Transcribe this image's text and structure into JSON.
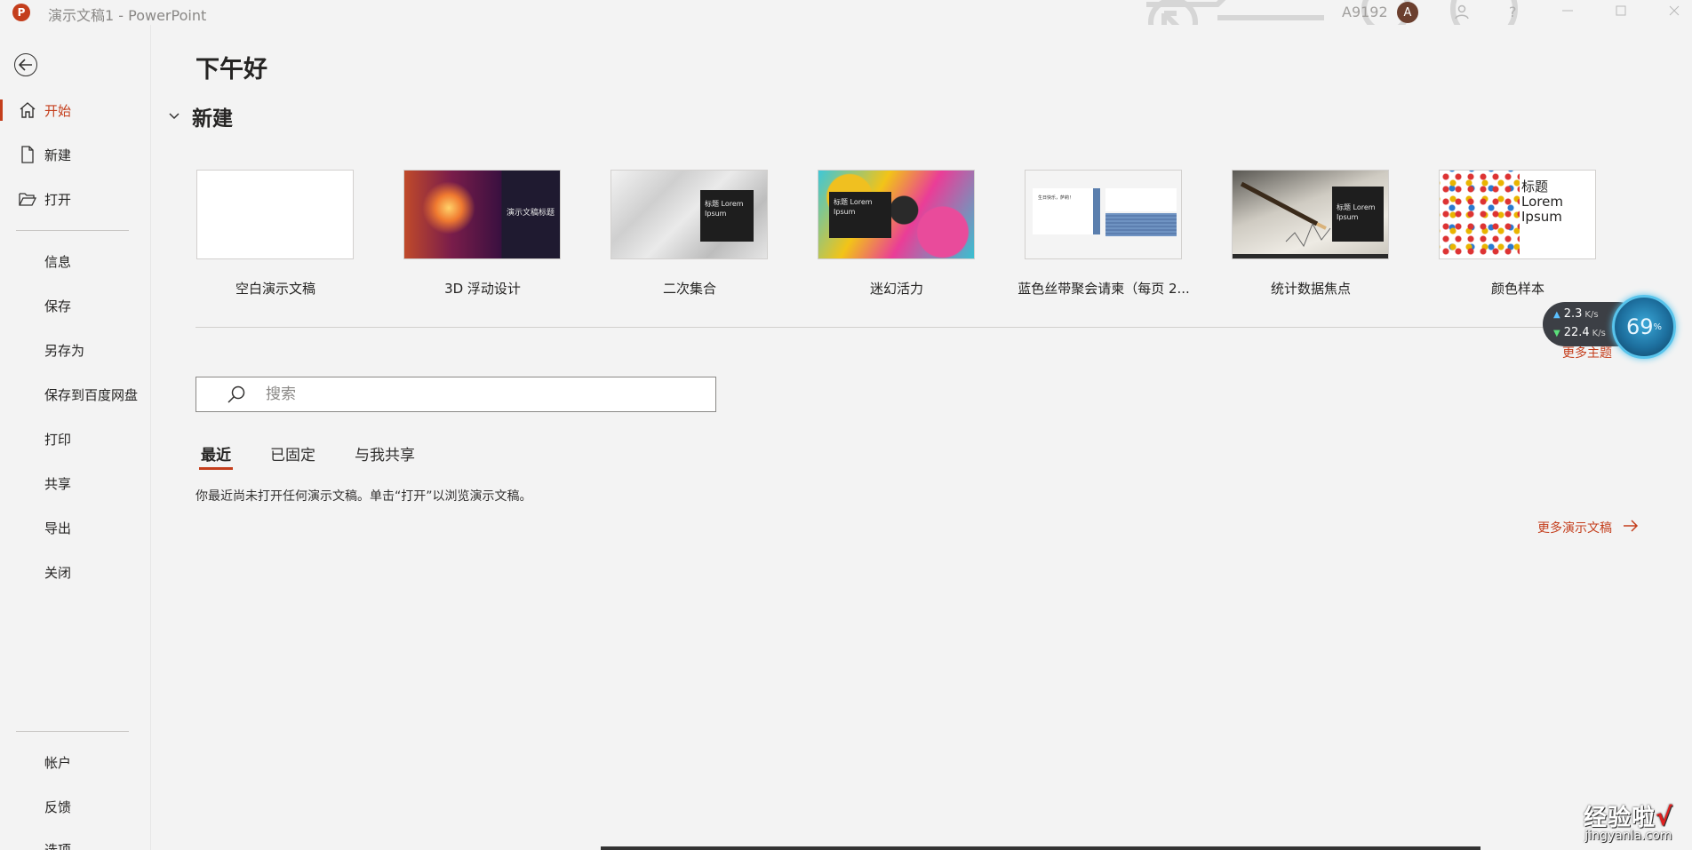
{
  "window": {
    "title": "演示文稿1  -  PowerPoint",
    "app_logo": "P",
    "user_id": "A9192",
    "avatar_letter": "A",
    "help": "?"
  },
  "sidebar": {
    "back_label": "←",
    "items": [
      {
        "label": "开始",
        "icon": "home-icon",
        "active": true
      },
      {
        "label": "新建",
        "icon": "new-document-icon"
      },
      {
        "label": "打开",
        "icon": "folder-icon"
      },
      {
        "label": "信息"
      },
      {
        "label": "保存"
      },
      {
        "label": "另存为"
      },
      {
        "label": "保存到百度网盘"
      },
      {
        "label": "打印"
      },
      {
        "label": "共享"
      },
      {
        "label": "导出"
      },
      {
        "label": "关闭"
      },
      {
        "label": "帐户"
      },
      {
        "label": "反馈"
      },
      {
        "label": "选项"
      }
    ]
  },
  "main": {
    "greeting": "下午好",
    "new_section_title": "新建",
    "templates": [
      {
        "name": "空白演示文稿"
      },
      {
        "name": "3D 浮动设计",
        "thumb_text": "演示文稿标题"
      },
      {
        "name": "二次集合",
        "thumb_text": "标题 Lorem Ipsum"
      },
      {
        "name": "迷幻活力",
        "thumb_text": "标题 Lorem Ipsum"
      },
      {
        "name": "蓝色丝带聚会请柬（每页 2...",
        "thumb_text": "生日快乐，萨莉！"
      },
      {
        "name": "统计数据焦点",
        "thumb_text": "标题 Lorem Ipsum"
      },
      {
        "name": "颜色样本",
        "thumb_text": "标题 Lorem Ipsum"
      }
    ],
    "more_themes": "更多主题",
    "search_placeholder": "搜索",
    "tabs": [
      {
        "label": "最近",
        "active": true
      },
      {
        "label": "已固定"
      },
      {
        "label": "与我共享"
      }
    ],
    "empty_message": "你最近尚未打开任何演示文稿。单击“打开”以浏览演示文稿。",
    "more_docs": "更多演示文稿"
  },
  "net_widget": {
    "upload": "2.3",
    "upload_unit": "K/s",
    "download": "22.4",
    "download_unit": "K/s",
    "percent": "69"
  },
  "watermark": {
    "main": "经验啦",
    "check": "√",
    "sub": "jingyanla.com"
  },
  "colors": {
    "accent": "#c43e1c",
    "background": "#f3f3f3"
  }
}
